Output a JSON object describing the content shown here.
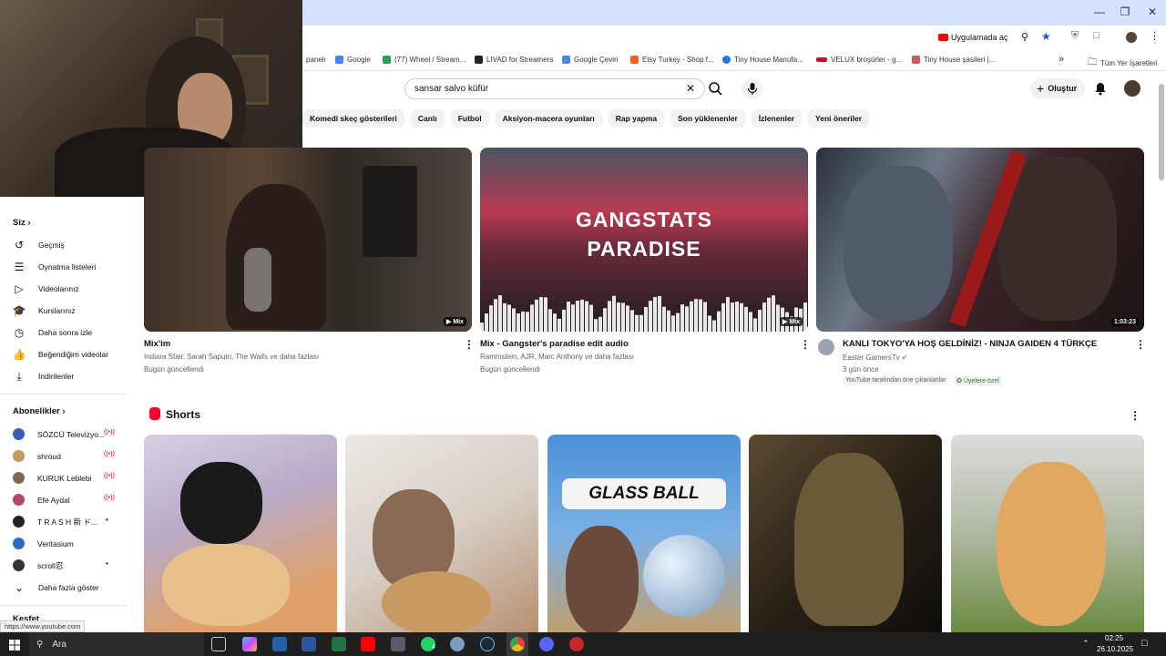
{
  "browser": {
    "open_in_app": "Uygulamada aç",
    "bookmarks": [
      {
        "label": "panelı",
        "color": "#888888"
      },
      {
        "label": "Google",
        "color": "#4285f4"
      },
      {
        "label": "(77) Wheel / Stream...",
        "color": "#1d9bf0"
      },
      {
        "label": "LIVAD for Streamers",
        "color": "#222222"
      },
      {
        "label": "Google Çeviri",
        "color": "#4285f4"
      },
      {
        "label": "Etsy Turkey - Shop f...",
        "color": "#f1641e"
      },
      {
        "label": "Tiny House Manufa...",
        "color": "#1877f2"
      },
      {
        "label": "VELUX broşürler - g...",
        "color": "#c8102e"
      },
      {
        "label": "Tiny House şasileri |...",
        "color": "#d9534f"
      }
    ],
    "all_bookmarks": "Tüm Yer İşaretleri",
    "status_url": "https://www.youtube.com"
  },
  "header": {
    "search_value": "sansar salvo küfür",
    "create_label": "Oluştur"
  },
  "chips": [
    "Komedi skeç gösterileri",
    "Canlı",
    "Futbol",
    "Aksiyon-macera oyunları",
    "Rap yapma",
    "Son yüklenenler",
    "İzlenenler",
    "Yeni öneriler"
  ],
  "sidebar": {
    "you_label": "Siz",
    "you_items": [
      {
        "label": "Geçmiş",
        "icon": "history-icon"
      },
      {
        "label": "Oynatma listeleri",
        "icon": "playlist-icon"
      },
      {
        "label": "Videolarınız",
        "icon": "your-videos-icon"
      },
      {
        "label": "Kurslarınız",
        "icon": "courses-icon"
      },
      {
        "label": "Daha sonra izle",
        "icon": "watch-later-icon"
      },
      {
        "label": "Beğendiğim videolar",
        "icon": "like-icon"
      },
      {
        "label": "İndirilenler",
        "icon": "download-icon"
      }
    ],
    "subs_label": "Abonelikler",
    "subs": [
      {
        "label": "SÖZCÜ Televizyo...",
        "live": true,
        "color": "#3b5bb5"
      },
      {
        "label": "shroud",
        "live": true,
        "color": "#c49a5a"
      },
      {
        "label": "KURUK Leblebi",
        "live": true,
        "color": "#7a6a5a"
      },
      {
        "label": "Efe Aydal",
        "live": true,
        "color": "#b04a6a"
      },
      {
        "label": "T R A S H 新 ド...",
        "live": false,
        "color": "#222222"
      },
      {
        "label": "Veritasium",
        "live": false,
        "color": "#2d6bc4"
      },
      {
        "label": "scroll忍",
        "live": false,
        "color": "#333333"
      }
    ],
    "show_more": "Daha fazla göster",
    "explore_label": "Keşfet"
  },
  "videos": [
    {
      "title": "Mix'im",
      "meta1": "Indiara Sfair, Sarah Saputri, The Waifs ve daha fazlası",
      "meta2": "Bugün güncellendi",
      "badge": "Mix"
    },
    {
      "title": "Mix - Gangster's paradise edit audio",
      "meta1": "Rammstein, AJR, Marc Anthony ve daha fazlası",
      "meta2": "Bugün güncellendi",
      "badge": "Mix",
      "thumb_text1": "GANGSTATS",
      "thumb_text2": "PARADISE"
    },
    {
      "title": "KANLI TOKYO'YA HOŞ GELDİNİZ! - NINJA GAIDEN 4 TÜRKÇE",
      "channel": "Easter GamersTv",
      "meta2": "3 gün önce",
      "duration": "1:03:23",
      "tag1": "YouTube tarafından öne çıkanlanlar",
      "tag2": "Üyelere özel"
    }
  ],
  "shorts": {
    "title": "Shorts",
    "glass_ball": "GLASS BALL"
  },
  "taskbar": {
    "search": "Ara",
    "time": "02:25",
    "date": "26.10.2025",
    "whatsapp_count": "4"
  }
}
